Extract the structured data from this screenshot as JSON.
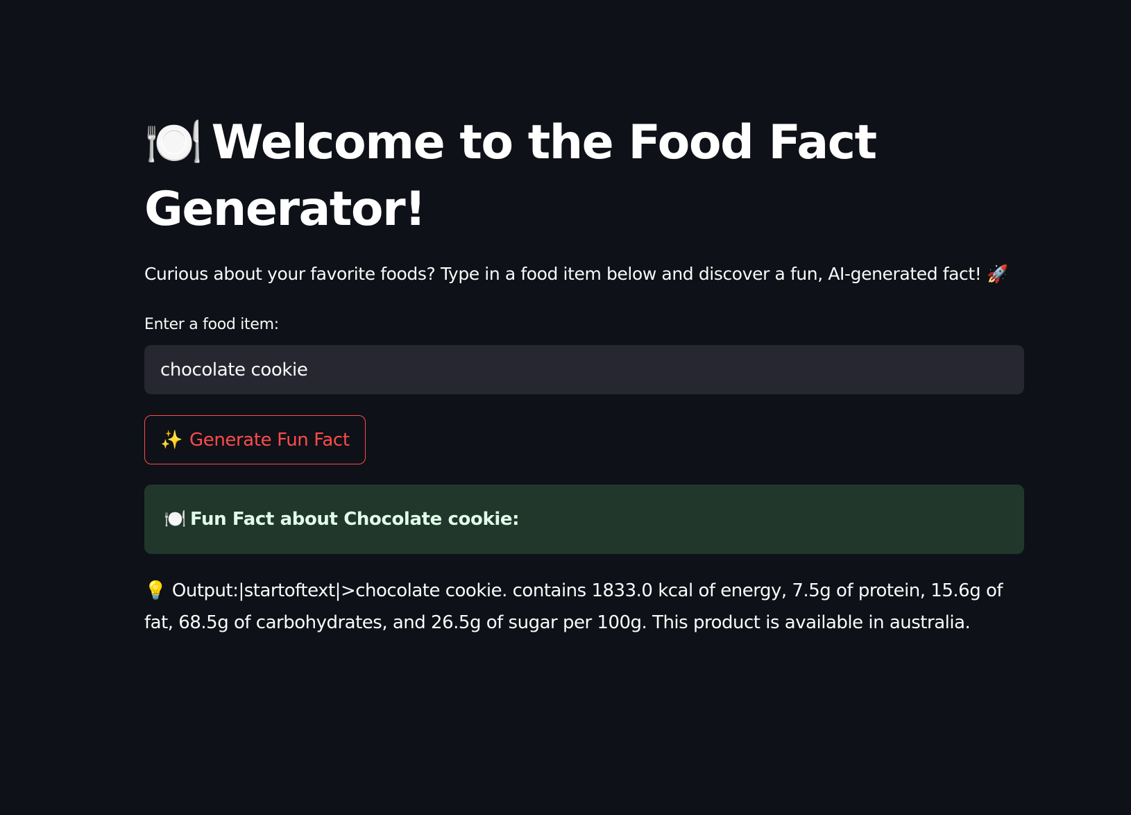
{
  "header": {
    "title_icon": "🍽️",
    "title_text": "Welcome to the Food Fact Generator!"
  },
  "intro": {
    "text": "Curious about your favorite foods? Type in a food item below and discover a fun, AI-generated fact! 🚀"
  },
  "form": {
    "input_label": "Enter a food item:",
    "input_value": "chocolate cookie",
    "button_icon": "✨",
    "button_label": "Generate Fun Fact"
  },
  "result": {
    "heading_icon": "🍽️",
    "heading_text": "Fun Fact about Chocolate cookie:",
    "output_icon": "💡",
    "output_text": "Output:|startoftext|>chocolate cookie. contains 1833.0 kcal of energy, 7.5g of protein, 15.6g of fat, 68.5g of carbohydrates, and 26.5g of sugar per 100g. This product is available in australia."
  },
  "colors": {
    "background": "#0e1117",
    "input_background": "#262730",
    "accent": "#ff4b4b",
    "success_background": "#21372b",
    "success_text": "#dffde9"
  }
}
